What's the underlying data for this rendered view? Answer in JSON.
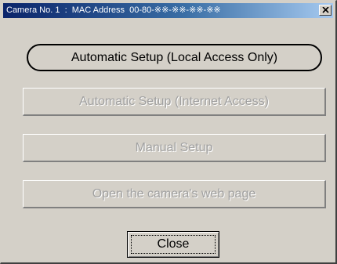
{
  "window": {
    "title": "Camera No. 1  :  MAC Address  00-80-※※-※※-※※-※※",
    "close_glyph": "✕"
  },
  "buttons": {
    "auto_local": "Automatic Setup (Local Access Only)",
    "auto_internet": "Automatic Setup (Internet Access)",
    "manual": "Manual Setup",
    "open_web": "Open the camera's web page",
    "close": "Close"
  },
  "icons": {
    "titlebar_close": "close-icon"
  }
}
